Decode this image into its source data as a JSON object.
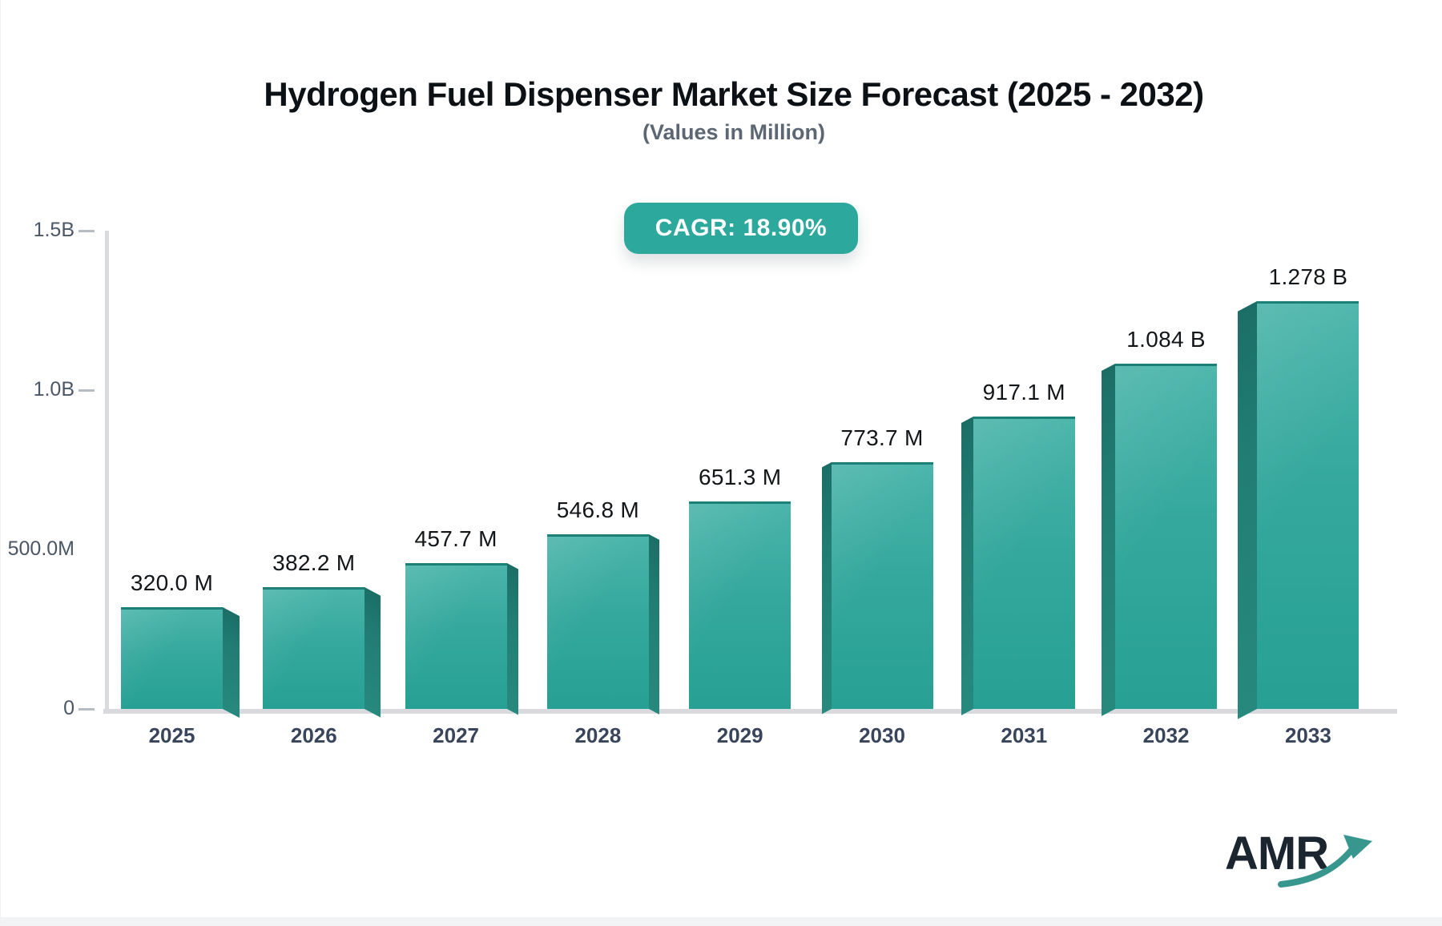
{
  "title": "Hydrogen Fuel Dispenser Market Size Forecast (2025 - 2032)",
  "subtitle": "(Values in Million)",
  "badge": {
    "label": "CAGR: 18.90%"
  },
  "logo": {
    "text": "AMR",
    "icon": "trend-arrow-icon"
  },
  "colors": {
    "accent_teal": "#2ca89c",
    "bar_face_top": "#4ab4aa",
    "bar_face_bottom": "#27a093",
    "bar_side_dark": "#217d73",
    "axis_gray": "#d8dade",
    "tick_label": "#4b5666",
    "year_label": "#39455a",
    "value_label": "#131619",
    "logo_navy": "#1a2530"
  },
  "chart_data": {
    "type": "bar",
    "categories": [
      "2025",
      "2026",
      "2027",
      "2028",
      "2029",
      "2030",
      "2031",
      "2032",
      "2033"
    ],
    "values": [
      320.0,
      382.2,
      457.7,
      546.8,
      651.3,
      773.7,
      917.1,
      1084,
      1278
    ],
    "value_labels": [
      "320.0 M",
      "382.2 M",
      "457.7 M",
      "546.8 M",
      "651.3 M",
      "773.7 M",
      "917.1 M",
      "1.084 B",
      "1.278 B"
    ],
    "unit": "Million",
    "title": "Hydrogen Fuel Dispenser Market Size Forecast (2025 - 2032)",
    "xlabel": "",
    "ylabel": "",
    "ylim": [
      0,
      1500
    ],
    "grid": "off",
    "legend": "none",
    "bar_style": "3d-beveled-teal",
    "y_ticks": [
      {
        "label": "1.5B",
        "value": 1500
      },
      {
        "label": "1.0B",
        "value": 1000
      },
      {
        "label": "500.0M",
        "value": 500
      },
      {
        "label": "0",
        "value": 0
      }
    ]
  }
}
